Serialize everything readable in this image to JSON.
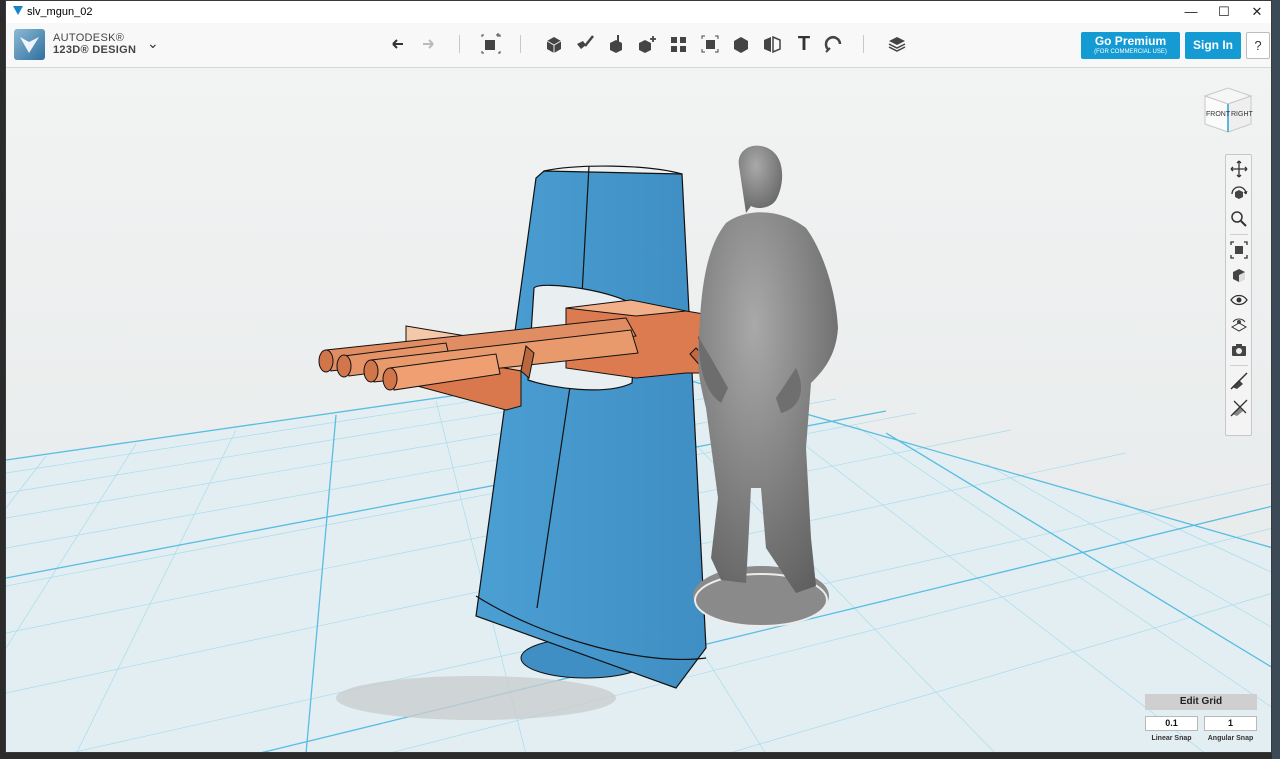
{
  "window": {
    "title": "slv_mgun_02",
    "controls": {
      "minimize": "—",
      "maximize": "☐",
      "close": "✕"
    }
  },
  "brand": {
    "line1": "AUTODESK®",
    "line2": "123D® DESIGN",
    "menu_chevron": "⌄"
  },
  "toolbar": {
    "undo_icon": "undo-icon",
    "redo_icon": "redo-icon",
    "tools": [
      "transform-icon",
      "primitives-icon",
      "sketch-icon",
      "construct-icon",
      "modify-icon",
      "pattern-icon",
      "grouping-icon",
      "combine-icon",
      "measure-icon",
      "text-icon",
      "snap-icon",
      "material-icon"
    ],
    "text_tool_label": "T"
  },
  "account": {
    "premium_label": "Go Premium",
    "premium_sub": "(FOR COMMERCIAL USE)",
    "signin_label": "Sign In",
    "help_label": "?"
  },
  "viewcube": {
    "front_label": "FRONT",
    "right_label": "RIGHT"
  },
  "nav_tools": [
    "pan-icon",
    "orbit-icon",
    "zoom-icon",
    "fit-icon",
    "views-icon",
    "visibility-icon",
    "materials-outline-icon",
    "camera-icon",
    "snap-off-icon",
    "snap-grid-icon"
  ],
  "grid": {
    "edit_label": "Edit Grid",
    "linear_value": "0.1",
    "linear_label": "Linear Snap",
    "angular_value": "1",
    "angular_label": "Angular Snap"
  },
  "colors": {
    "accent": "#159bd4",
    "model_blue": "#4d9fd1",
    "model_copper": "#e0845a",
    "figure_gray": "#7d7d7d",
    "grid_line": "#8fd3ea"
  }
}
